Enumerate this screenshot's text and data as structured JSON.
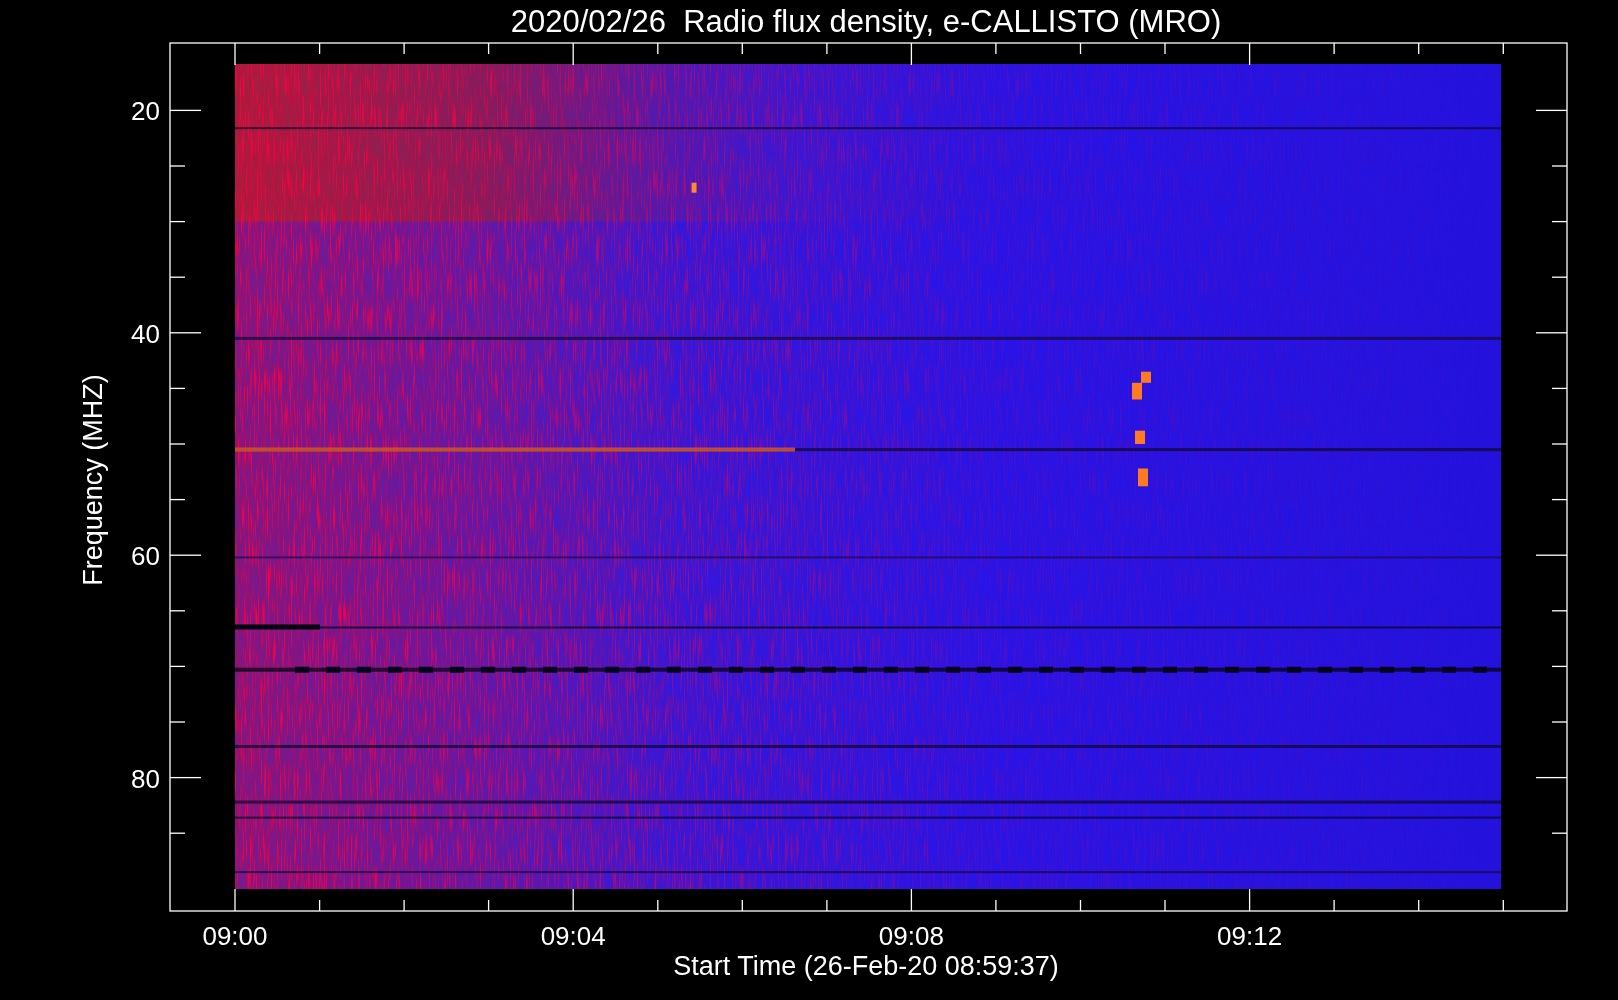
{
  "plot": {
    "title": "2020/02/26  Radio flux density, e-CALLISTO (MRO)",
    "ylabel": "Frequency (MHZ)",
    "xlabel": "Start Time (26-Feb-20 08:59:37)",
    "y_tick_labels": [
      "20",
      "40",
      "60",
      "80"
    ],
    "x_tick_labels": [
      "09:00",
      "09:04",
      "09:08",
      "09:12"
    ]
  }
}
